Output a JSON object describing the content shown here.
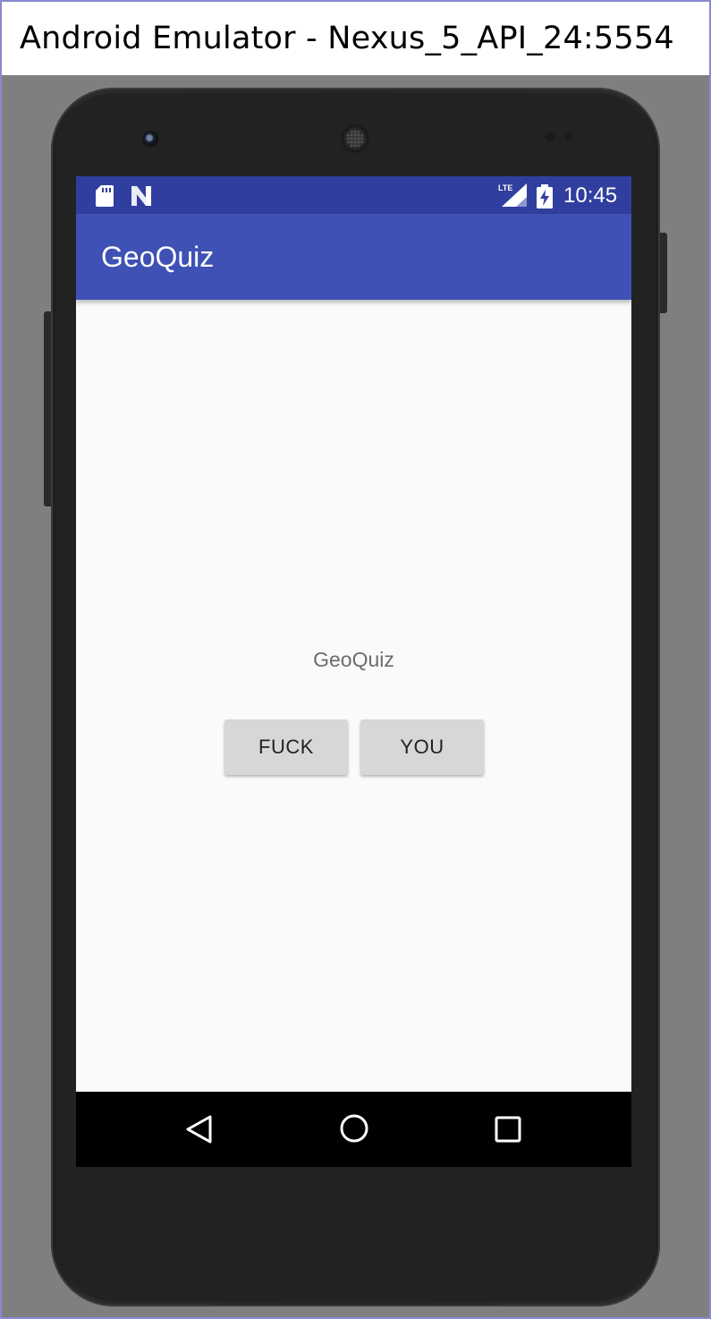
{
  "window": {
    "title": "Android Emulator - Nexus_5_API_24:5554"
  },
  "status_bar": {
    "time": "10:45",
    "network_label": "LTE",
    "icons": [
      "sd-card-icon",
      "n-icon",
      "lte-signal-icon",
      "battery-charging-icon"
    ],
    "color": "#303f9f"
  },
  "app_bar": {
    "title": "GeoQuiz",
    "color": "#3f51b5"
  },
  "content": {
    "question_text": "GeoQuiz",
    "buttons": {
      "true_label": "FUCK",
      "false_label": "YOU"
    }
  },
  "nav_bar": {
    "items": [
      "back-icon",
      "home-icon",
      "recents-icon"
    ]
  }
}
